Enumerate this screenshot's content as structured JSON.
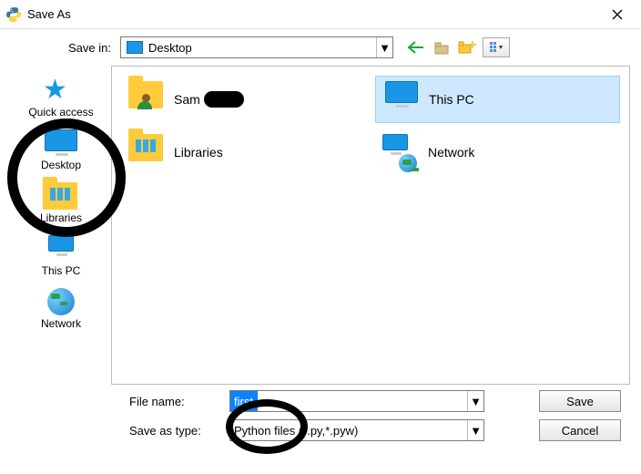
{
  "titlebar": {
    "title": "Save As"
  },
  "saveIn": {
    "label": "Save in:",
    "value": "Desktop"
  },
  "sidebar": {
    "items": [
      {
        "label": "Quick access"
      },
      {
        "label": "Desktop"
      },
      {
        "label": "Libraries"
      },
      {
        "label": "This PC"
      },
      {
        "label": "Network"
      }
    ]
  },
  "content": {
    "items": [
      {
        "label": "Sam",
        "redacted": true
      },
      {
        "label": "This PC",
        "selected": true
      },
      {
        "label": "Libraries"
      },
      {
        "label": "Network"
      }
    ]
  },
  "fileName": {
    "label": "File name:",
    "value": "first"
  },
  "saveType": {
    "label": "Save as type:",
    "value": "Python files (*.py,*.pyw)"
  },
  "buttons": {
    "save": "Save",
    "cancel": "Cancel"
  }
}
